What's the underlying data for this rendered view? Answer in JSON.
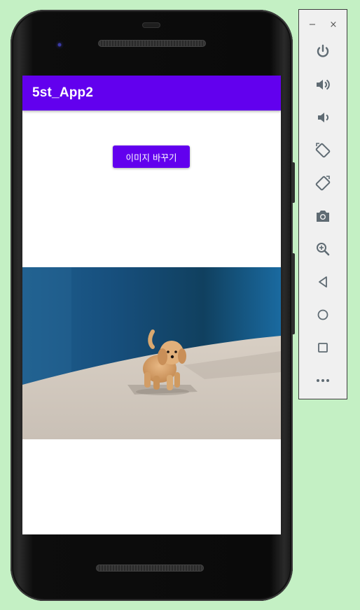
{
  "app": {
    "title": "5st_App2",
    "button_label": "이미지 바꾸기",
    "image_alt": "puppy-photo"
  },
  "emulator": {
    "minimize_label": "−",
    "close_label": "×",
    "tools": [
      {
        "name": "power-icon"
      },
      {
        "name": "volume-up-icon"
      },
      {
        "name": "volume-down-icon"
      },
      {
        "name": "rotate-left-icon"
      },
      {
        "name": "rotate-right-icon"
      },
      {
        "name": "camera-icon"
      },
      {
        "name": "zoom-icon"
      },
      {
        "name": "back-icon"
      },
      {
        "name": "home-icon"
      },
      {
        "name": "overview-icon"
      },
      {
        "name": "more-icon"
      }
    ]
  },
  "colors": {
    "primary": "#6200ee",
    "background": "#c4f0c4",
    "icon": "#5f6b73"
  }
}
